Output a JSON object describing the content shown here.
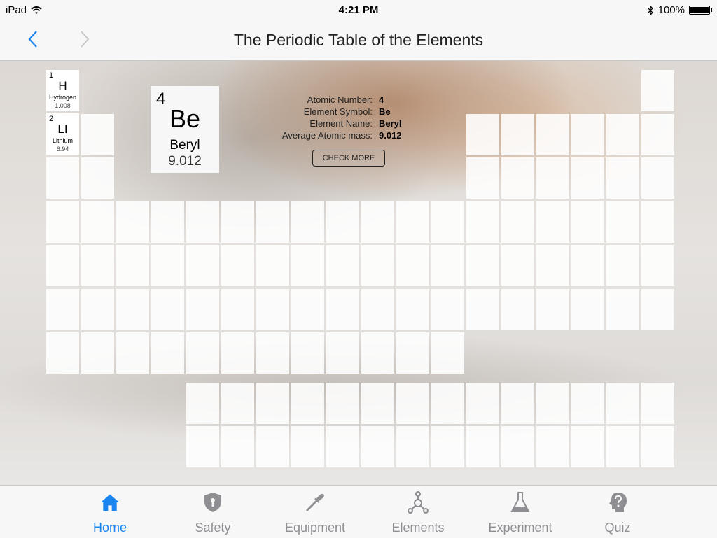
{
  "status_bar": {
    "device": "iPad",
    "time": "4:21 PM",
    "battery": "100%"
  },
  "nav": {
    "title": "The Periodic Table of the Elements"
  },
  "elements": [
    {
      "number": "1",
      "symbol": "H",
      "name": "Hydrogen",
      "mass": "1.008"
    },
    {
      "number": "2",
      "symbol": "LI",
      "name": "Lithium",
      "mass": "6.94"
    }
  ],
  "selected": {
    "number": "4",
    "symbol": "Be",
    "name": "Beryl",
    "mass": "9.012"
  },
  "info": {
    "atomic_number_label": "Atomic Number:",
    "atomic_number": "4",
    "symbol_label": "Element Symbol:",
    "symbol": "Be",
    "name_label": "Element Name:",
    "name": "Beryl",
    "mass_label": "Average Atomic mass:",
    "mass": "9.012",
    "check_more": "CHECK MORE"
  },
  "tabs": [
    {
      "label": "Home",
      "icon": "home-icon",
      "active": true
    },
    {
      "label": "Safety",
      "icon": "shield-lock-icon",
      "active": false
    },
    {
      "label": "Equipment",
      "icon": "dropper-icon",
      "active": false
    },
    {
      "label": "Elements",
      "icon": "molecule-icon",
      "active": false
    },
    {
      "label": "Experiment",
      "icon": "flask-icon",
      "active": false
    },
    {
      "label": "Quiz",
      "icon": "question-head-icon",
      "active": false
    }
  ],
  "colors": {
    "accent": "#1a84ef",
    "inactive": "#8e8e93"
  }
}
